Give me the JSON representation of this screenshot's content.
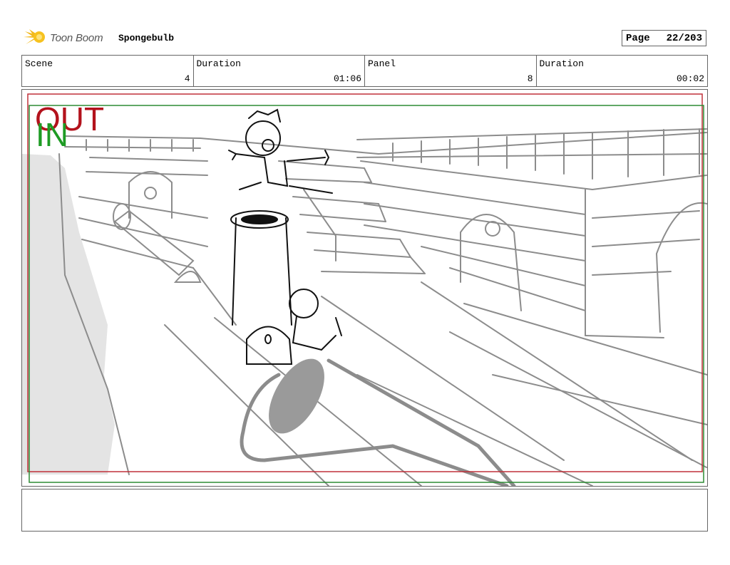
{
  "header": {
    "logo_text": "Toon Boom",
    "project": "Spongebulb",
    "page_label": "Page",
    "page_value": "22/203"
  },
  "info": [
    {
      "label": "Scene",
      "value": "4"
    },
    {
      "label": "Duration",
      "value": "01:06"
    },
    {
      "label": "Panel",
      "value": "8"
    },
    {
      "label": "Duration",
      "value": "00:02"
    }
  ],
  "panel": {
    "out_label": "OUT",
    "in_label": "IN",
    "out_color": "#b3121c",
    "in_color": "#1e9b24"
  },
  "notes": {
    "text": ""
  },
  "icons": {
    "logo": "toon-boom-star-icon"
  }
}
